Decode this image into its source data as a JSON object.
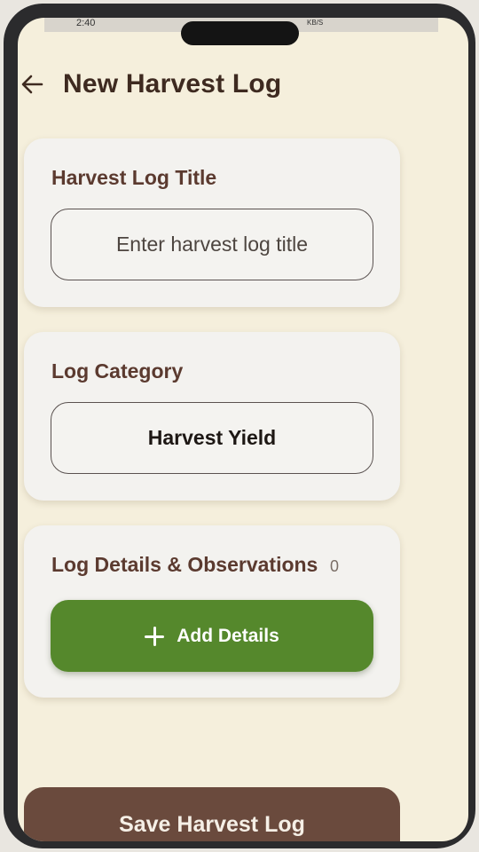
{
  "status_bar": {
    "time": "2:40",
    "net_speed": "KB/S"
  },
  "header": {
    "title": "New Harvest Log",
    "back_icon": "arrow-left-icon"
  },
  "title_card": {
    "label": "Harvest Log Title",
    "placeholder": "Enter harvest log title",
    "value": ""
  },
  "category_card": {
    "label": "Log Category",
    "selected_value": "Harvest Yield"
  },
  "details_card": {
    "label": "Log Details & Observations",
    "count": "0",
    "add_button_label": "Add Details",
    "add_icon": "plus-icon"
  },
  "footer": {
    "save_label": "Save Harvest Log"
  },
  "colors": {
    "background": "#f5efdc",
    "card": "#f3f2ef",
    "title_text": "#3e2a20",
    "label_text": "#5b3a2f",
    "add_button": "#55882c",
    "save_button": "#6a4a3d"
  }
}
